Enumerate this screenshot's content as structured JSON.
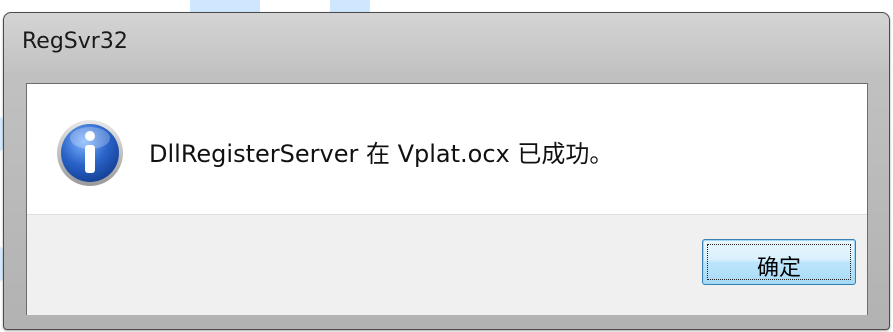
{
  "dialog": {
    "title": "RegSvr32",
    "message": "DllRegisterServer 在 Vplat.ocx 已成功。",
    "icon": "information-icon",
    "ok_button_label": "确定"
  },
  "colors": {
    "title_bar": "#c8c8c8",
    "content_background": "#ffffff",
    "button_bar_background": "#f0f0f0",
    "button_border": "#3c7fb1",
    "icon_blue": "#1d58b8"
  }
}
